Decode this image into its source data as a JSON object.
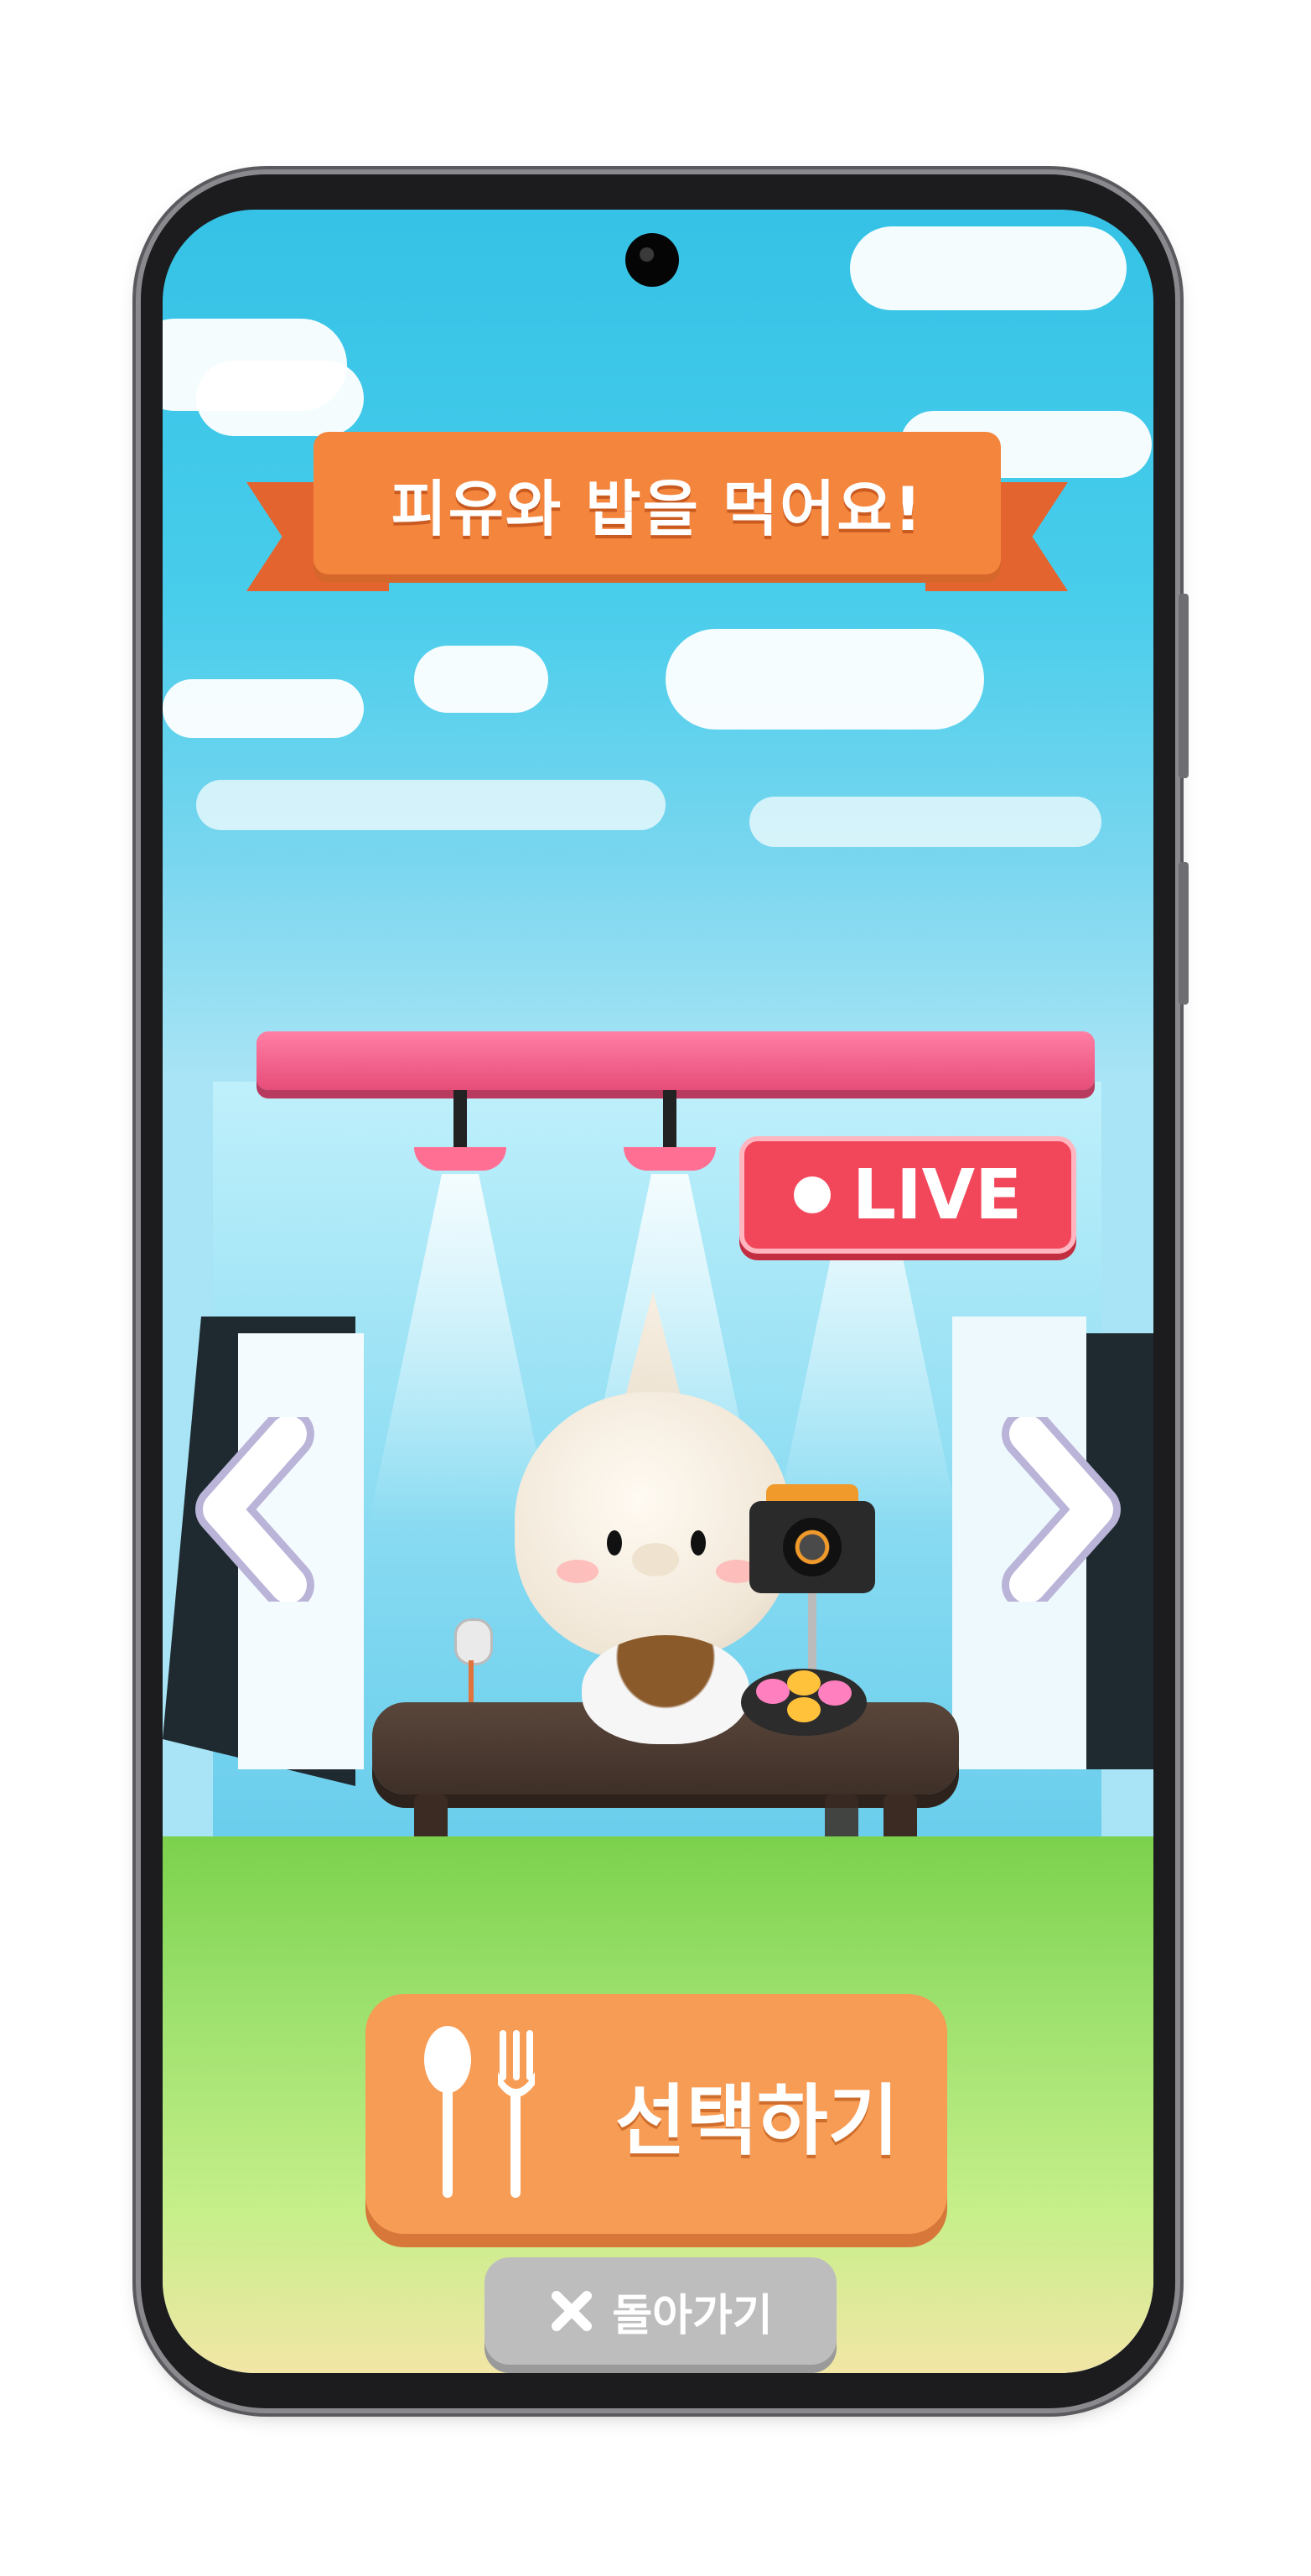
{
  "banner": {
    "title": "피유와 밥을 먹어요!"
  },
  "live_badge": {
    "label": "LIVE"
  },
  "nav": {
    "prev_icon": "chevron-left-icon",
    "next_icon": "chevron-right-icon"
  },
  "select_button": {
    "label": "선택하기",
    "icon": "spoon-fork-icon"
  },
  "back_button": {
    "label": "돌아가기",
    "icon": "close-icon"
  },
  "colors": {
    "banner": "#f3853d",
    "live": "#f2475a",
    "select": "#f79c55",
    "back": "#bdbdbd",
    "sky": "#35c2e6",
    "grass": "#7bd14c"
  }
}
